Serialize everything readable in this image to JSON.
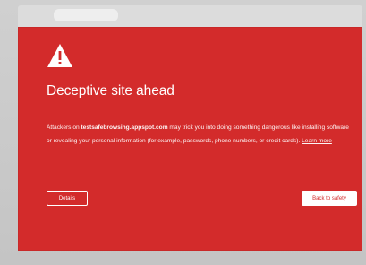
{
  "interstitial": {
    "icon": "warning-triangle-icon",
    "heading": "Deceptive site ahead",
    "body_prefix": "Attackers on ",
    "site": "testsafebrowsing.appspot.com",
    "body_middle": " may trick you into doing something dangerous like installing software or revealing your personal information (for example, passwords, phone numbers, or credit cards). ",
    "learn_more": "Learn more",
    "details_label": "Details",
    "back_label": "Back to safety"
  },
  "colors": {
    "background": "#d32b2b",
    "text": "#ffffff"
  }
}
